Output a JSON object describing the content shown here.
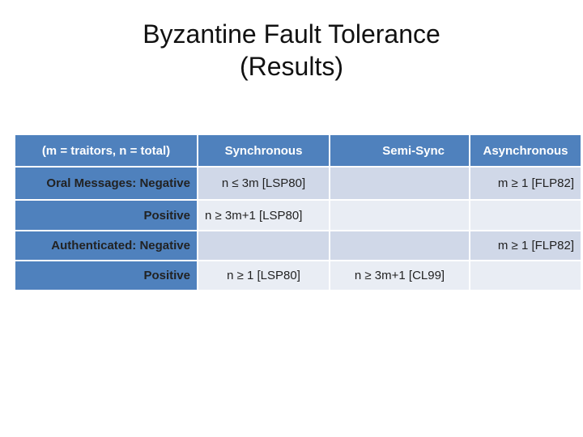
{
  "title": {
    "line1": "Byzantine Fault Tolerance",
    "line2": "(Results)"
  },
  "table": {
    "headers": [
      "(m = traitors, n = total)",
      "Synchronous",
      "Semi-Sync",
      "Asynchronous"
    ],
    "rows": [
      {
        "label": "Oral Messages: Negative",
        "synchronous": "n ≤ 3m [LSP80]",
        "semi_sync": "",
        "asynchronous": "m  ≥  1 [FLP82]"
      },
      {
        "label": "Positive",
        "synchronous": "n  ≥ 3m+1 [LSP80]",
        "semi_sync": "",
        "asynchronous": ""
      },
      {
        "label": "Authenticated: Negative",
        "synchronous": "",
        "semi_sync": "",
        "asynchronous": "m  ≥  1 [FLP82]"
      },
      {
        "label": "Positive",
        "synchronous": "n   ≥  1 [LSP80]",
        "semi_sync": "n ≥ 3m+1 [CL99]",
        "asynchronous": ""
      }
    ]
  },
  "colors": {
    "header_blue": "#4F81BD",
    "row_dark": "#D0D8E8",
    "row_light": "#E9EDF4"
  }
}
